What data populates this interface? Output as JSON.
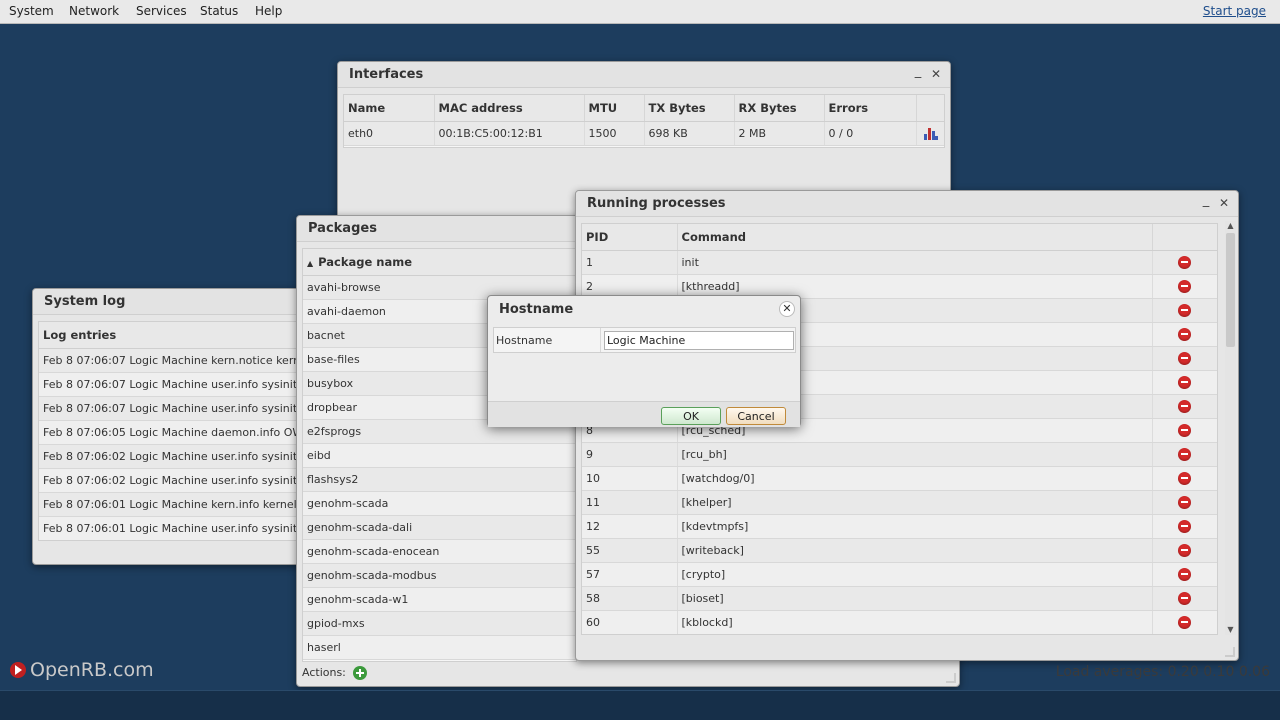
{
  "menubar": {
    "items": [
      "System",
      "Network",
      "Services",
      "Status",
      "Help"
    ],
    "start_page": "Start page"
  },
  "footer": {
    "brand": "OpenRB.com",
    "load_averages": "Load averages: 0.20 0.10 0.06"
  },
  "interfaces": {
    "title": "Interfaces",
    "columns": [
      "Name",
      "MAC address",
      "MTU",
      "TX Bytes",
      "RX Bytes",
      "Errors"
    ],
    "rows": [
      {
        "name": "eth0",
        "mac": "00:1B:C5:00:12:B1",
        "mtu": "1500",
        "tx": "698 KB",
        "rx": "2 MB",
        "errors": "0 / 0",
        "icon": "bar-chart-icon"
      }
    ]
  },
  "syslog": {
    "title": "System log",
    "column": "Log entries",
    "entries": [
      "Feb 8 07:06:07 Logic Machine kern.notice kernel: [ 2",
      "Feb 8 07:06:07 Logic Machine user.info sysinit: Start",
      "Feb 8 07:06:07 Logic Machine user.info sysinit: Gene",
      "Feb 8 07:06:05 Logic Machine daemon.info OWFS[86",
      "Feb 8 07:06:02 Logic Machine user.info sysinit: curre",
      "Feb 8 07:06:02 Logic Machine user.info sysinit: /lib/g",
      "Feb 8 07:06:01 Logic Machine kern.info kernel: [ 15.8",
      "Feb 8 07:06:01 Logic Machine user.info sysinit: /dev/"
    ]
  },
  "packages": {
    "title": "Packages",
    "column": "Package name",
    "items": [
      "avahi-browse",
      "avahi-daemon",
      "bacnet",
      "base-files",
      "busybox",
      "dropbear",
      "e2fsprogs",
      "eibd",
      "flashsys2",
      "genohm-scada",
      "genohm-scada-dali",
      "genohm-scada-enocean",
      "genohm-scada-modbus",
      "genohm-scada-w1",
      "gpiod-mxs",
      "haserl"
    ],
    "actions_label": "Actions:"
  },
  "processes": {
    "title": "Running processes",
    "columns": [
      "PID",
      "Command"
    ],
    "rows": [
      {
        "pid": "1",
        "cmd": "init"
      },
      {
        "pid": "2",
        "cmd": "[kthreadd]"
      },
      {
        "pid": "",
        "cmd": ""
      },
      {
        "pid": "",
        "cmd": ""
      },
      {
        "pid": "",
        "cmd": ""
      },
      {
        "pid": "",
        "cmd": ""
      },
      {
        "pid": "",
        "cmd": ""
      },
      {
        "pid": "8",
        "cmd": "[rcu_sched]"
      },
      {
        "pid": "9",
        "cmd": "[rcu_bh]"
      },
      {
        "pid": "10",
        "cmd": "[watchdog/0]"
      },
      {
        "pid": "11",
        "cmd": "[khelper]"
      },
      {
        "pid": "12",
        "cmd": "[kdevtmpfs]"
      },
      {
        "pid": "55",
        "cmd": "[writeback]"
      },
      {
        "pid": "57",
        "cmd": "[crypto]"
      },
      {
        "pid": "58",
        "cmd": "[bioset]"
      },
      {
        "pid": "60",
        "cmd": "[kblockd]"
      }
    ]
  },
  "dialog": {
    "title": "Hostname",
    "field_label": "Hostname",
    "field_value": "Logic Machine",
    "ok": "OK",
    "cancel": "Cancel"
  }
}
